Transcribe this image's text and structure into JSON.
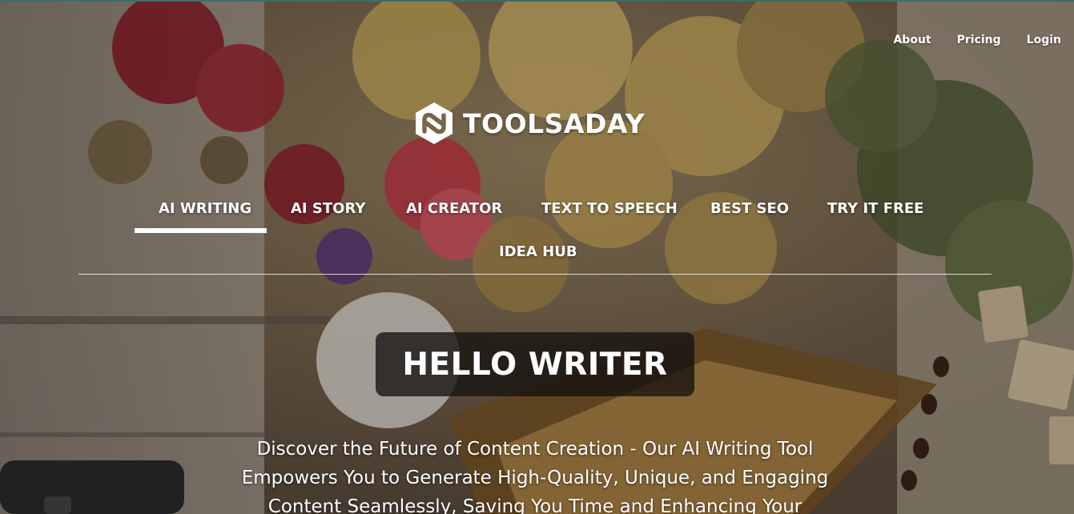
{
  "top_nav": {
    "about": "About",
    "pricing": "Pricing",
    "login": "Login"
  },
  "logo": {
    "text": "TOOLSADAY",
    "icon": "toolsaday-logo-icon"
  },
  "main_nav": {
    "items": [
      {
        "label": "AI WRITING",
        "active": true
      },
      {
        "label": "AI STORY",
        "active": false
      },
      {
        "label": "AI CREATOR",
        "active": false
      },
      {
        "label": "TEXT TO SPEECH",
        "active": false
      },
      {
        "label": "BEST SEO",
        "active": false
      },
      {
        "label": "TRY IT FREE",
        "active": false
      },
      {
        "label": "IDEA HUB",
        "active": false
      }
    ]
  },
  "hero": {
    "heading": "HELLO WRITER",
    "tagline": "Discover the Future of Content Creation - Our AI Writing Tool Empowers You to Generate High-Quality, Unique, and Engaging Content Seamlessly, Saving You Time and Enhancing Your"
  },
  "colors": {
    "heading_box": "#141210",
    "text": "#ffffff",
    "accent_top": "#3a6e6a"
  }
}
